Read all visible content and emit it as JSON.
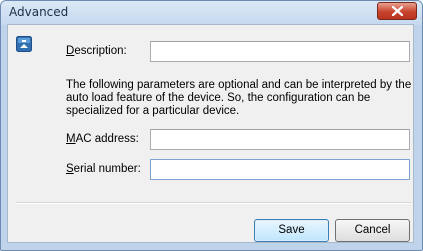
{
  "window": {
    "title": "Advanced",
    "close_icon": "close-x-icon"
  },
  "form": {
    "icon": "info-icon",
    "description": {
      "label_ul": "D",
      "label_rest": "escription:",
      "value": ""
    },
    "note_lines": [
      "The following parameters are optional and can be interpreted by the",
      "auto load feature of the device. So, the configuration can be",
      "specialized for a particular device."
    ],
    "mac": {
      "label_ul": "M",
      "label_rest": "AC address:",
      "value": ""
    },
    "serial": {
      "label_ul": "S",
      "label_rest": "erial number:",
      "value": ""
    }
  },
  "buttons": {
    "save": "Save",
    "cancel": "Cancel"
  },
  "colors": {
    "close_button": "#c8442e",
    "default_button_border": "#3c7fb1",
    "focused_field_border": "#7da2ce"
  }
}
